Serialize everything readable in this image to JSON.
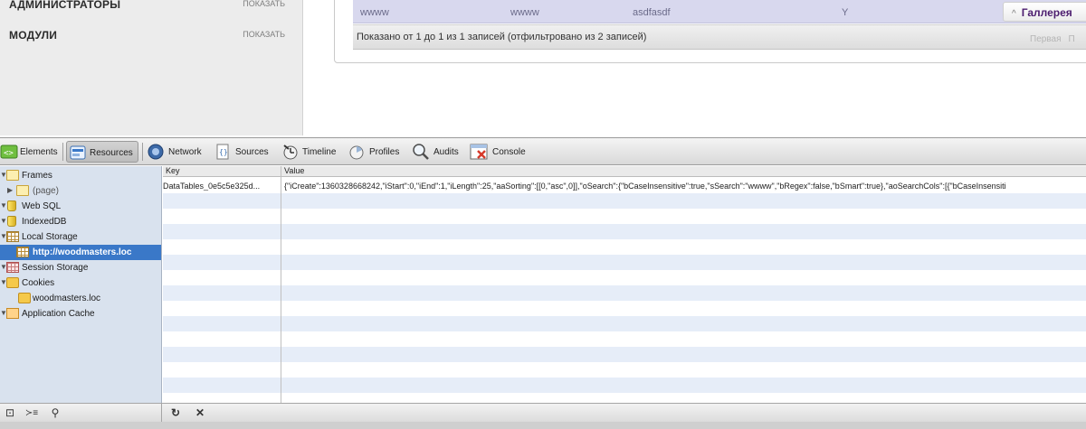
{
  "sidebar": {
    "items": [
      {
        "title": "АДМИНИСТРАТОРЫ",
        "action": "ПОКАЗАТЬ"
      },
      {
        "title": "МОДУЛИ",
        "action": "ПОКАЗАТЬ"
      }
    ]
  },
  "datatable": {
    "row": {
      "c1": "wwww",
      "c2": "wwww",
      "c3": "asdfasdf",
      "c4": "Y"
    },
    "gallery_button": "Галлерея",
    "info": "Показано от 1 до 1 из 1 записей (отфильтровано из 2 записей)",
    "pager": {
      "first": "Первая",
      "prev": "П"
    }
  },
  "devtools": {
    "tabs": [
      "Elements",
      "Resources",
      "Network",
      "Sources",
      "Timeline",
      "Profiles",
      "Audits",
      "Console"
    ],
    "selected_tab": "Resources",
    "tree": [
      {
        "label": "Frames"
      },
      {
        "label": "(page)"
      },
      {
        "label": "Web SQL"
      },
      {
        "label": "IndexedDB"
      },
      {
        "label": "Local Storage"
      },
      {
        "label": "http://woodmasters.loc"
      },
      {
        "label": "Session Storage"
      },
      {
        "label": "Cookies"
      },
      {
        "label": "woodmasters.loc"
      },
      {
        "label": "Application Cache"
      }
    ],
    "grid": {
      "columns": [
        "Key",
        "Value"
      ],
      "rows": [
        {
          "key": "DataTables_0e5c5e325d...",
          "value": "{\"iCreate\":1360328668242,\"iStart\":0,\"iEnd\":1,\"iLength\":25,\"aaSorting\":[[0,\"asc\",0]],\"oSearch\":{\"bCaseInsensitive\":true,\"sSearch\":\"wwww\",\"bRegex\":false,\"bSmart\":true},\"aoSearchCols\":[{\"bCaseInsensiti"
        }
      ]
    },
    "status_buttons": {
      "dock": "⊡",
      "console": "≻≡",
      "search": "⚲",
      "refresh": "↻",
      "delete": "✕"
    }
  }
}
